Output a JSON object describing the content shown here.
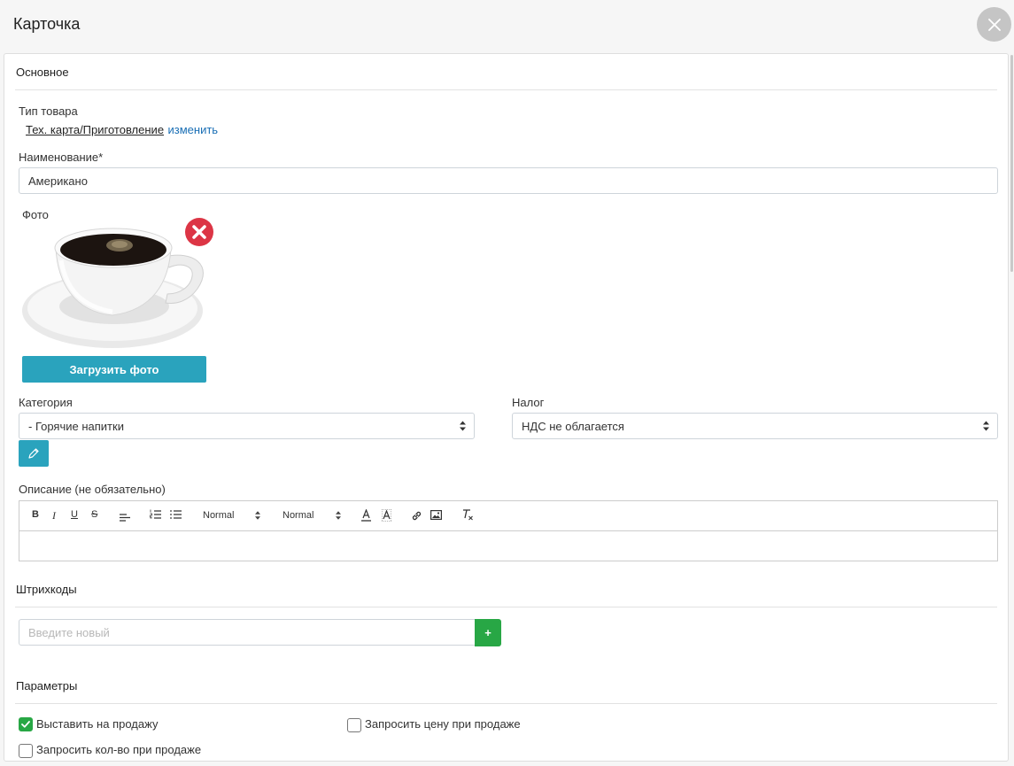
{
  "header": {
    "title": "Карточка",
    "close_icon": "close-icon"
  },
  "sections": {
    "main": "Основное",
    "barcodes": "Штрихкоды",
    "params": "Параметры"
  },
  "product_type": {
    "label": "Тип товара",
    "value": "Тех. карта/Приготовление",
    "change_link": "изменить"
  },
  "name": {
    "label": "Наименование*",
    "value": "Американо"
  },
  "photo": {
    "label": "Фото",
    "upload_label": "Загрузить фото",
    "remove_icon": "remove-icon",
    "image": "coffee-cup"
  },
  "category": {
    "label": "Категория",
    "value": "- Горячие напитки",
    "edit_icon": "pencil-icon"
  },
  "tax": {
    "label": "Налог",
    "value": "НДС не облагается"
  },
  "description": {
    "label": "Описание (не обязательно)",
    "toolbar": {
      "bold": "B",
      "italic": "I",
      "underline": "U",
      "strike": "S",
      "header_select": "Normal",
      "size_select": "Normal"
    }
  },
  "barcodes": {
    "placeholder": "Введите новый",
    "add_label": "+"
  },
  "params": {
    "for_sale": {
      "label": "Выставить на продажу",
      "checked": true
    },
    "ask_price": {
      "label": "Запросить цену при продаже",
      "checked": false
    },
    "ask_qty": {
      "label": "Запросить кол-во при продаже",
      "checked": false
    }
  },
  "colors": {
    "accent": "#2aa3bd",
    "success": "#28a745",
    "danger": "#dc3545",
    "link": "#1a6fb5"
  }
}
